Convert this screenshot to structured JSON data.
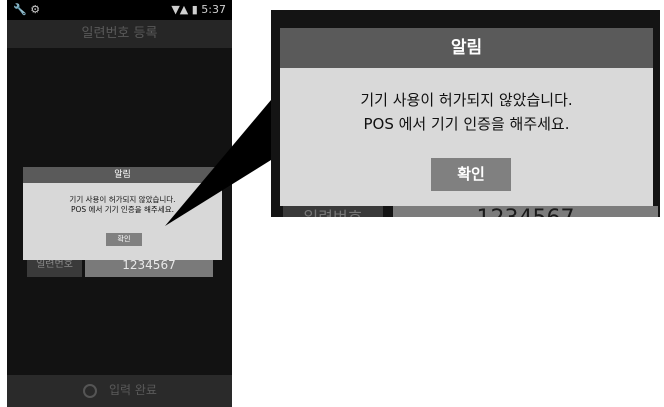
{
  "status_bar": {
    "left_icons": "🔧 ⚙",
    "right_icons": "▼▲ ▮",
    "time": "5:37"
  },
  "title_bar": {
    "title": "일련번호 등록"
  },
  "serial": {
    "label": "일련번호",
    "value": "1234567"
  },
  "bottom": {
    "label": "입력 완료"
  },
  "dialog": {
    "title": "알림",
    "message_line1": "기기 사용이 허가되지 않았습니다.",
    "message_line2": "POS 에서 기기 인증을 해주세요.",
    "confirm": "확인"
  },
  "colors": {
    "dialog_bg": "#d9d9d9",
    "title_bar": "#5a5a5a",
    "button": "#808080",
    "screen_bg": "#121212"
  }
}
